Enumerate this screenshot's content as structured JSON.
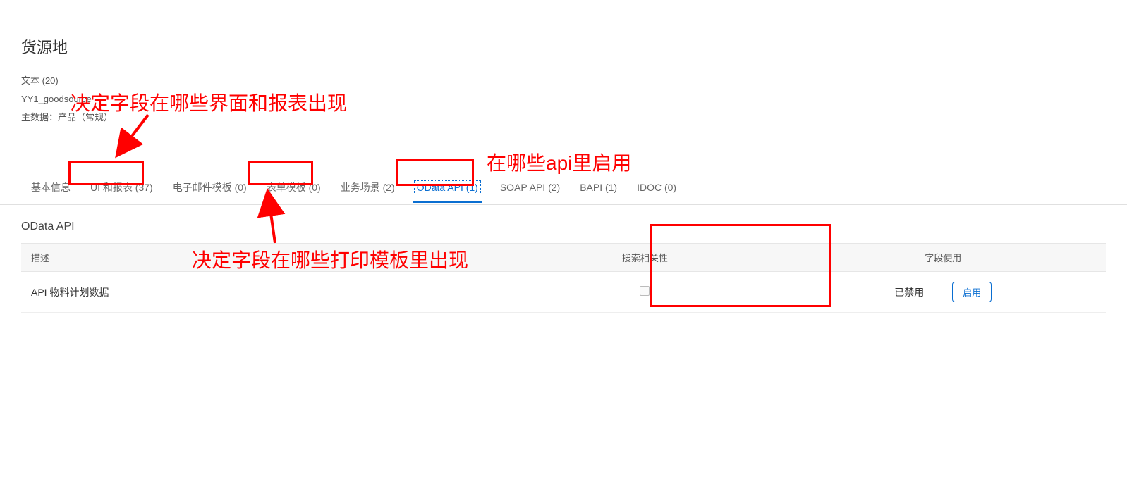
{
  "header": {
    "title": "货源地",
    "meta_text": "文本 (20)",
    "meta_source": "YY1_goodsource",
    "meta_master": "主数据：产品（常规）"
  },
  "tabs": [
    {
      "label": "基本信息"
    },
    {
      "label": "UI 和报表 (37)"
    },
    {
      "label": "电子邮件模板 (0)"
    },
    {
      "label": "表单模板 (0)"
    },
    {
      "label": "业务场景 (2)"
    },
    {
      "label": "OData API (1)",
      "active": true
    },
    {
      "label": "SOAP API (2)"
    },
    {
      "label": "BAPI (1)"
    },
    {
      "label": "IDOC (0)"
    }
  ],
  "section": {
    "title": "OData API",
    "columns": {
      "desc": "描述",
      "search": "搜索相关性",
      "usage": "字段使用"
    },
    "row": {
      "desc": "API 物料计划数据",
      "status": "已禁用",
      "button": "启用"
    }
  },
  "annotations": {
    "top": "决定字段在哪些界面和报表出现",
    "right_top": "在哪些api里启用",
    "middle": "决定字段在哪些打印模板里出现"
  }
}
